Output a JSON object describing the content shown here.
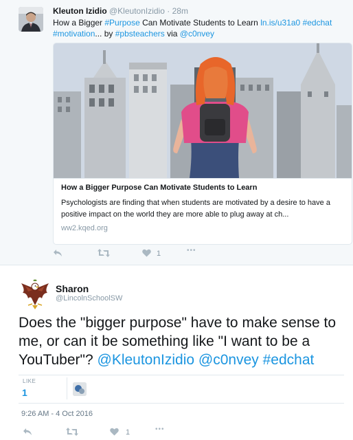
{
  "tweet1": {
    "author_name": "Kleuton Izidio",
    "author_handle": "@KleutonIzidio",
    "separator": "·",
    "time": "28m",
    "text": {
      "p1": "How a Bigger ",
      "hashtag_purpose": "#Purpose",
      "p2": " Can Motivate Students to Learn ",
      "link": "ln.is/u31a0",
      "p3": " ",
      "hashtag_edchat": "#edchat",
      "p4": " ",
      "hashtag_motivation": "#motivation",
      "p5": "... by ",
      "hashtag_pbsteachers": "#pbsteachers",
      "p6": " via ",
      "mention_c0nvey": "@c0nvey"
    },
    "card": {
      "title": "How a Bigger Purpose Can Motivate Students to Learn",
      "description": "Psychologists are finding that when students are motivated by a desire to have a positive impact on the world they are more able to plug away at ch...",
      "domain": "ww2.kqed.org"
    },
    "actions": {
      "reply_icon": "reply-icon",
      "retweet_icon": "retweet-icon",
      "like_icon": "heart-icon",
      "like_count": "1",
      "more_icon": "more-icon",
      "more_label": "•••"
    }
  },
  "tweet2": {
    "author_name": "Sharon",
    "author_handle": "@LincolnSchoolSW",
    "text": {
      "p1": "Does the \"bigger purpose\" have to make sense to me, or can it be something like \"I want to be a YouTuber\"? ",
      "mention_kleuton": "@KleutonIzidio",
      "p2": " ",
      "mention_c0nvey": "@c0nvey",
      "p3": " ",
      "hashtag_edchat": "#edchat"
    },
    "likes_label": "LIKE",
    "likes_count": "1",
    "date": "9:26 AM - 4 Oct 2016",
    "actions": {
      "reply_icon": "reply-icon",
      "retweet_icon": "retweet-icon",
      "like_icon": "heart-icon",
      "like_count": "1",
      "more_icon": "more-icon",
      "more_label": "•••"
    }
  },
  "colors": {
    "link": "#1b95e0",
    "muted": "#8899a6",
    "text": "#14171a",
    "background_top": "#f5f8fa"
  }
}
